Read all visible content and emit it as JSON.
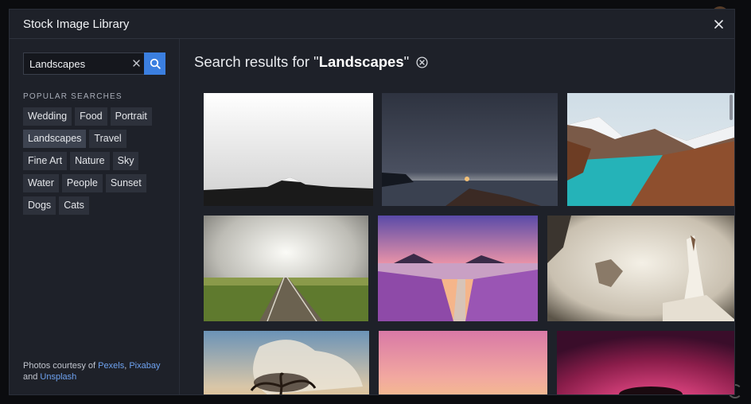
{
  "modal": {
    "title": "Stock Image Library"
  },
  "search": {
    "value": "Landscapes",
    "placeholder": ""
  },
  "icons": {
    "close": "close-icon",
    "clear": "clear-icon",
    "search": "search-icon",
    "clear_search": "circle-x-icon"
  },
  "popular": {
    "heading": "POPULAR SEARCHES",
    "rows": [
      [
        "Wedding",
        "Food",
        "Portrait"
      ],
      [
        "Landscapes",
        "Travel"
      ],
      [
        "Fine Art",
        "Nature",
        "Sky"
      ],
      [
        "Water",
        "People",
        "Sunset"
      ],
      [
        "Dogs",
        "Cats"
      ]
    ],
    "active": "Landscapes"
  },
  "credits": {
    "prefix": "Photos courtesy of ",
    "sources": [
      "Pexels",
      "Pixabay",
      "Unsplash"
    ],
    "sep1": ", ",
    "line2_prefix": "and "
  },
  "results": {
    "prefix": "Search results for \"",
    "query": "Landscapes",
    "suffix": "\""
  },
  "colors": {
    "accent": "#3b7fe0",
    "link": "#6ea2f0",
    "background": "#1e2129"
  }
}
